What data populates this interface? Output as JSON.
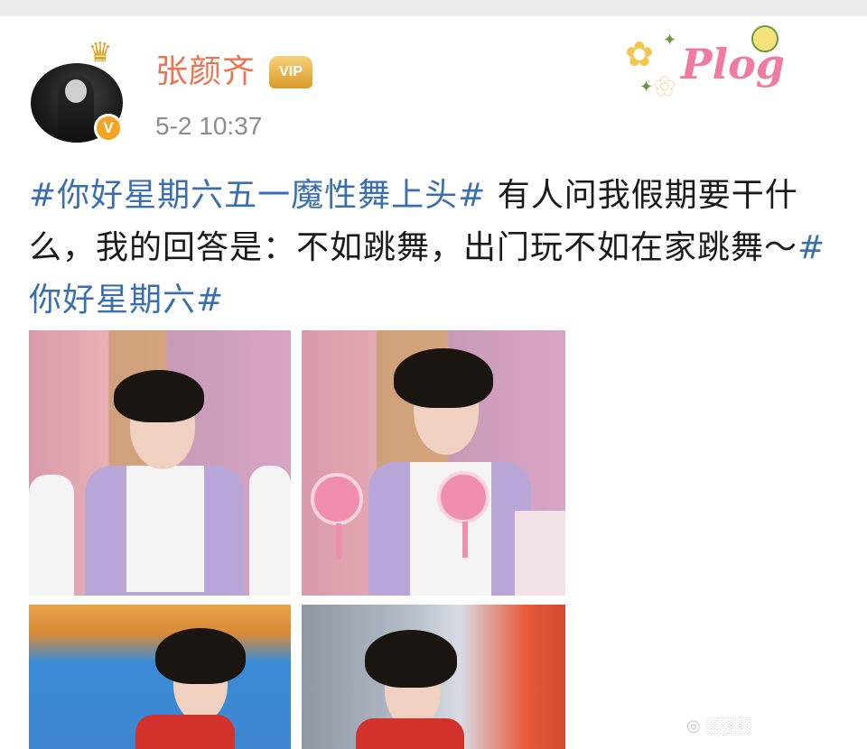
{
  "post": {
    "username": "张颜齐",
    "timestamp": "5-2 10:37",
    "tag1": "#你好星期六五一魔性舞上头#",
    "body": " 有人问我假期要干什么，我的回答是：不如跳舞，出门玩不如在家跳舞～",
    "tag2": "#你好星期六#",
    "sticker_word": "Plog"
  },
  "icons": {
    "avatar": "avatar-photo",
    "crown": "crown-icon",
    "verified": "verified-badge-icon",
    "vip": "vip-icon"
  },
  "badges": {
    "verified_letter": "V",
    "vip_label": "VIP"
  },
  "colors": {
    "username": "#eb7350",
    "tag": "#3a6fae",
    "timestamp": "#8c8c8c",
    "verified": "#f3a523"
  }
}
